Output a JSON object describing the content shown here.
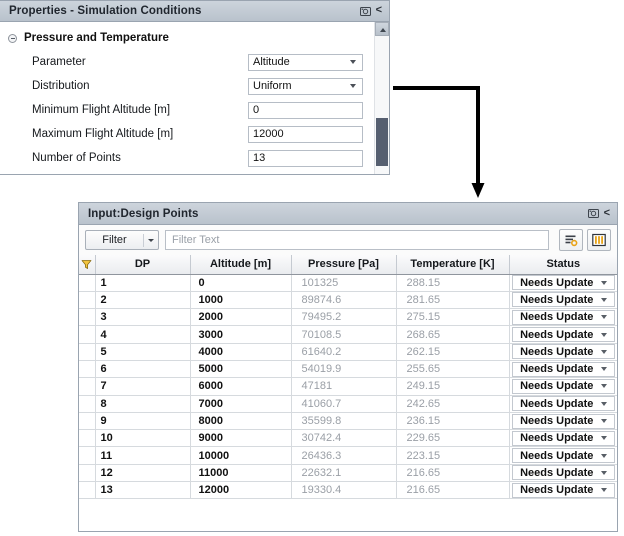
{
  "properties_panel": {
    "title": "Properties - Simulation Conditions",
    "icons": {
      "screenshot": "camera-icon",
      "collapse": "<"
    },
    "group": {
      "label": "Pressure and Temperature",
      "expander": "collapse-toggle-icon"
    },
    "rows": [
      {
        "label": "Parameter",
        "value": "Altitude",
        "type": "dropdown"
      },
      {
        "label": "Distribution",
        "value": "Uniform",
        "type": "dropdown"
      },
      {
        "label": "Minimum Flight Altitude [m]",
        "value": "0",
        "type": "text"
      },
      {
        "label": "Maximum Flight Altitude [m]",
        "value": "12000",
        "type": "text"
      },
      {
        "label": "Number of Points",
        "value": "13",
        "type": "text"
      }
    ]
  },
  "design_points_panel": {
    "title": "Input:Design Points",
    "icons": {
      "screenshot": "camera-icon",
      "collapse": "<"
    },
    "toolbar": {
      "filter_button_label": "Filter",
      "filter_text_placeholder": "Filter Text",
      "filter_text_value": "",
      "buttons": [
        {
          "name": "filter-options-icon"
        },
        {
          "name": "columns-icon"
        }
      ]
    },
    "table": {
      "filter_icon": "funnel-icon",
      "columns": [
        "DP",
        "Altitude [m]",
        "Pressure [Pa]",
        "Temperature [K]",
        "Status"
      ],
      "rows": [
        {
          "dp": "1",
          "altitude": "0",
          "pressure": "101325",
          "temperature": "288.15",
          "status": "Needs Update"
        },
        {
          "dp": "2",
          "altitude": "1000",
          "pressure": "89874.6",
          "temperature": "281.65",
          "status": "Needs Update"
        },
        {
          "dp": "3",
          "altitude": "2000",
          "pressure": "79495.2",
          "temperature": "275.15",
          "status": "Needs Update"
        },
        {
          "dp": "4",
          "altitude": "3000",
          "pressure": "70108.5",
          "temperature": "268.65",
          "status": "Needs Update"
        },
        {
          "dp": "5",
          "altitude": "4000",
          "pressure": "61640.2",
          "temperature": "262.15",
          "status": "Needs Update"
        },
        {
          "dp": "6",
          "altitude": "5000",
          "pressure": "54019.9",
          "temperature": "255.65",
          "status": "Needs Update"
        },
        {
          "dp": "7",
          "altitude": "6000",
          "pressure": "47181",
          "temperature": "249.15",
          "status": "Needs Update"
        },
        {
          "dp": "8",
          "altitude": "7000",
          "pressure": "41060.7",
          "temperature": "242.65",
          "status": "Needs Update"
        },
        {
          "dp": "9",
          "altitude": "8000",
          "pressure": "35599.8",
          "temperature": "236.15",
          "status": "Needs Update"
        },
        {
          "dp": "10",
          "altitude": "9000",
          "pressure": "30742.4",
          "temperature": "229.65",
          "status": "Needs Update"
        },
        {
          "dp": "11",
          "altitude": "10000",
          "pressure": "26436.3",
          "temperature": "223.15",
          "status": "Needs Update"
        },
        {
          "dp": "12",
          "altitude": "11000",
          "pressure": "22632.1",
          "temperature": "216.65",
          "status": "Needs Update"
        },
        {
          "dp": "13",
          "altitude": "12000",
          "pressure": "19330.4",
          "temperature": "216.65",
          "status": "Needs Update"
        }
      ]
    }
  },
  "connector": {
    "name": "flow-arrow",
    "color": "#000000"
  },
  "colors": {
    "accent_orange": "#e8a317",
    "title_bar": "#c3cbd4",
    "muted_text": "#9a9fa6",
    "scrollbar_thumb": "#565f70"
  }
}
